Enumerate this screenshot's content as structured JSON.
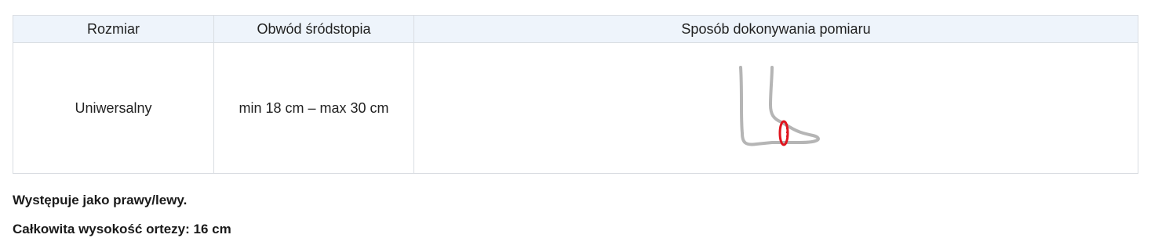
{
  "table": {
    "headers": [
      "Rozmiar",
      "Obwód śródstopia",
      "Sposób dokonywania pomiaru"
    ],
    "rows": [
      {
        "size": "Uniwersalny",
        "circumference": "min 18 cm – max 30 cm",
        "illustration_icon": "foot-measurement-icon"
      }
    ]
  },
  "notes": {
    "side": "Występuje jako prawy/lewy.",
    "height": "Całkowita wysokość ortezy: 16 cm"
  },
  "colors": {
    "header_bg": "#eef4fb",
    "border": "#d9dde2",
    "foot_outline": "#b5b5b5",
    "measure_marker": "#e0141e"
  }
}
